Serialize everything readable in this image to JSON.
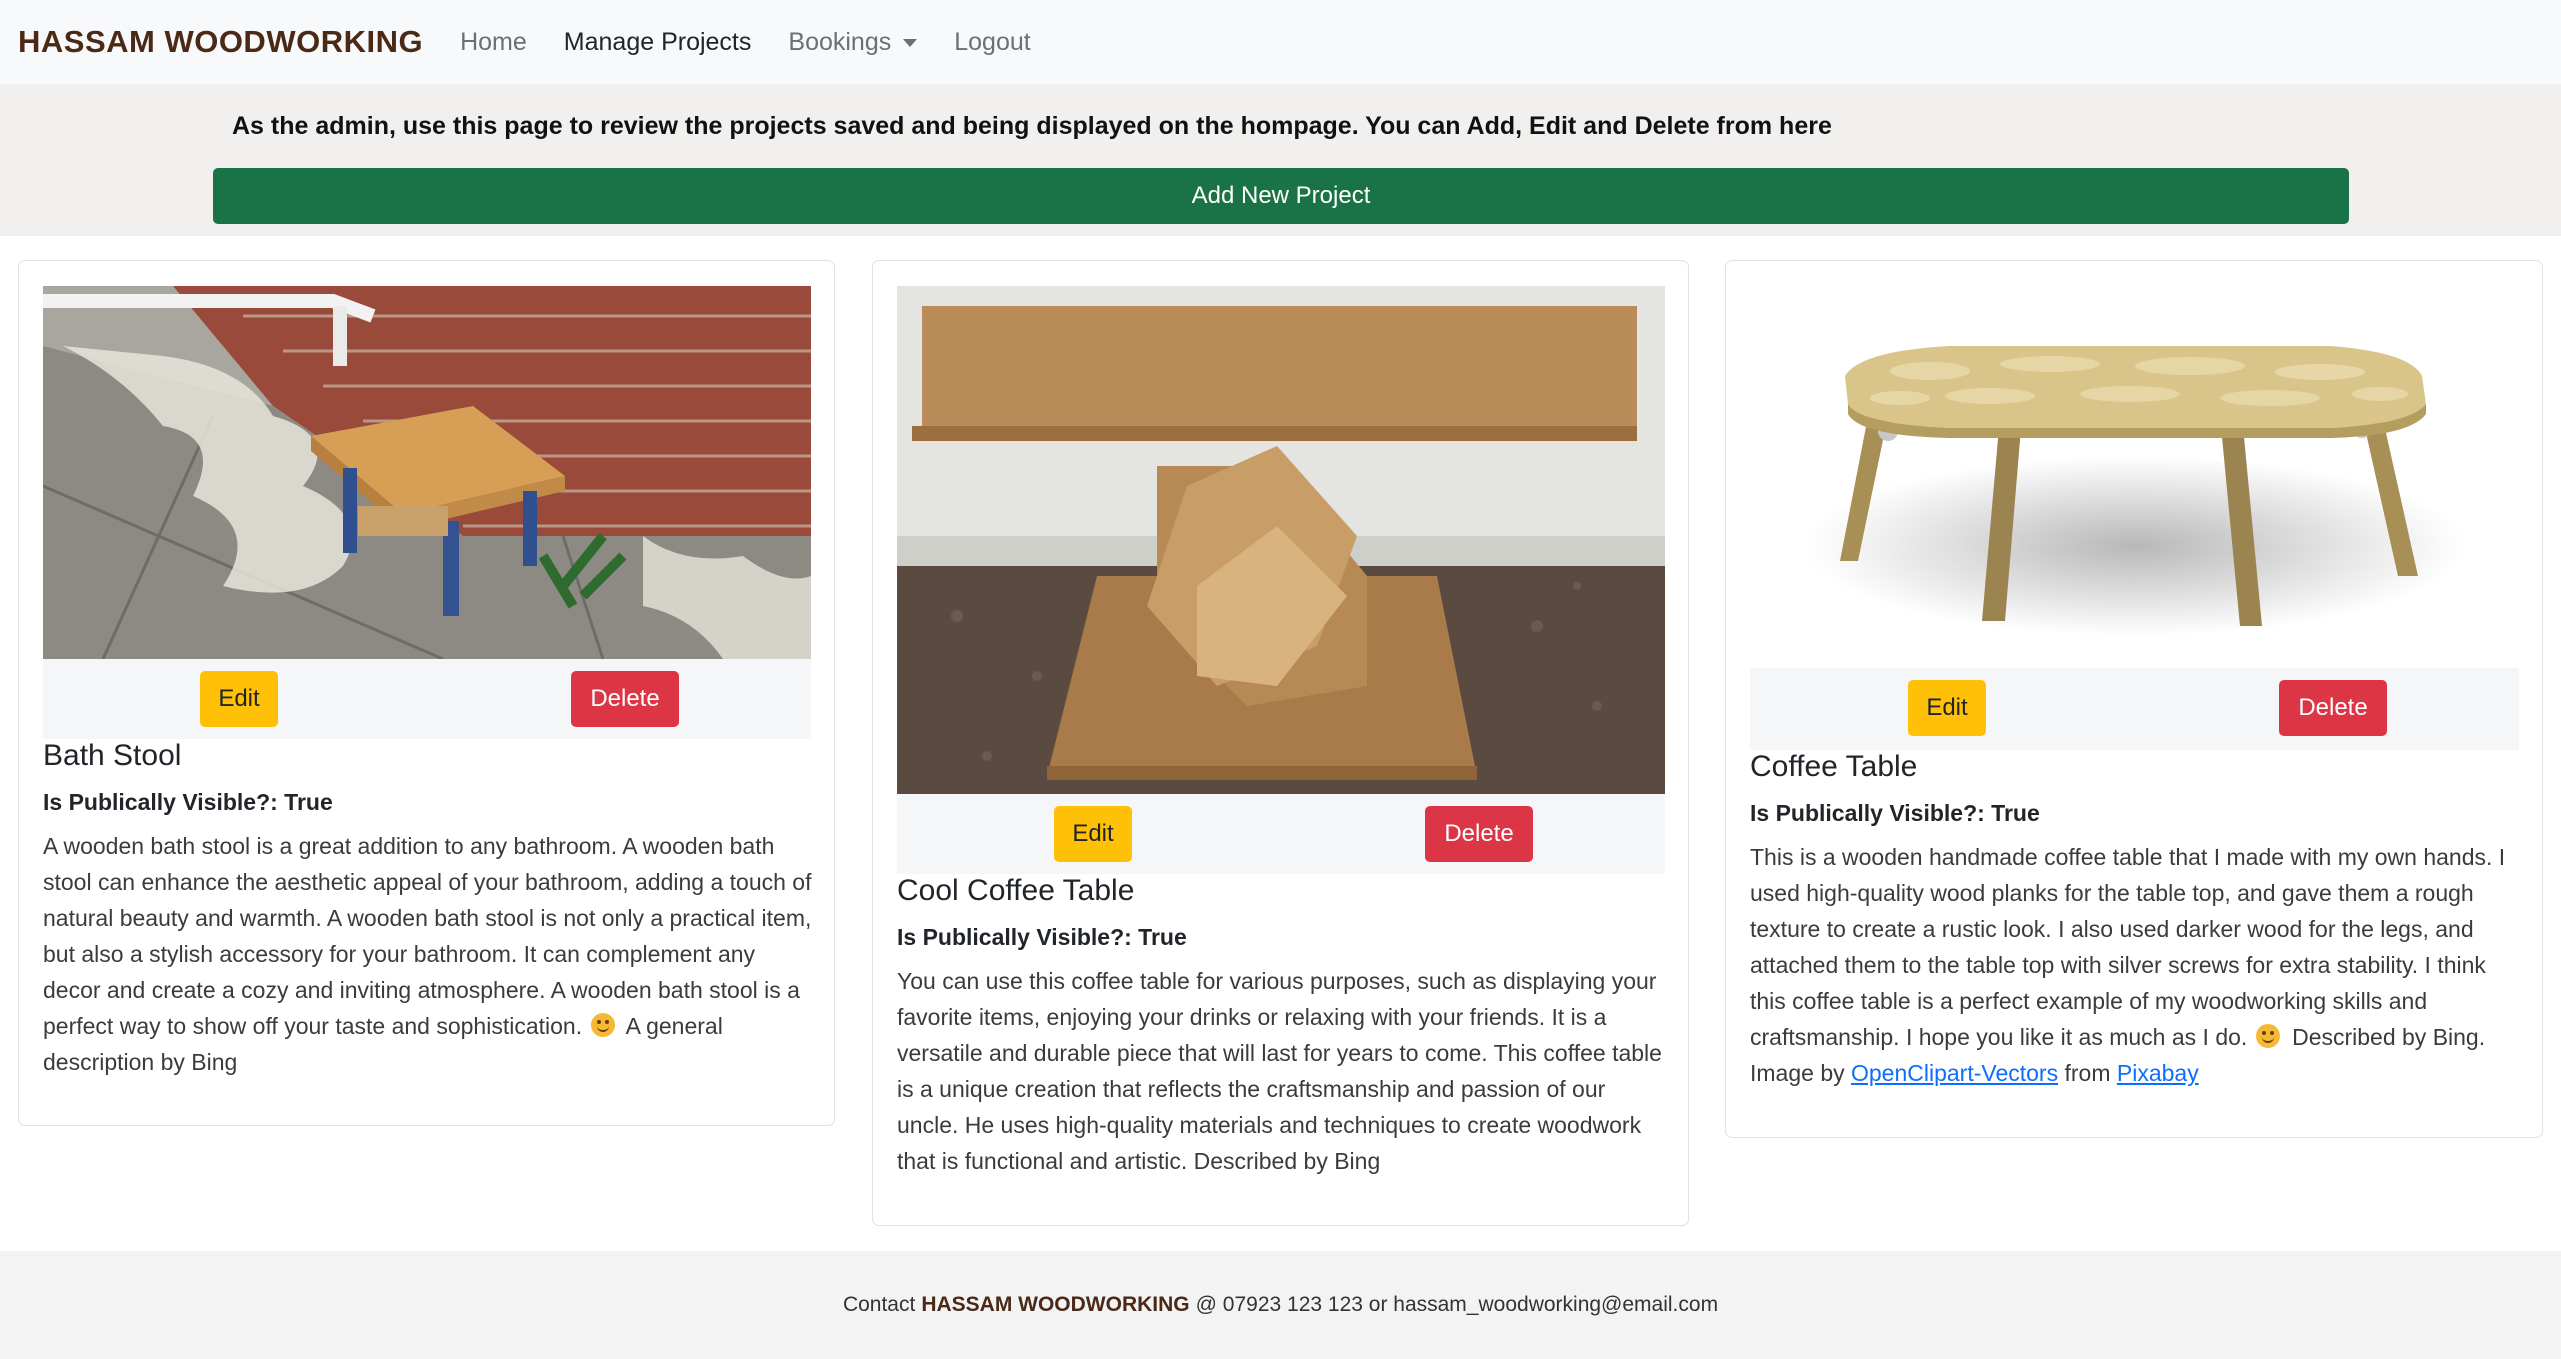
{
  "navbar": {
    "brand": "HASSAM WOODWORKING",
    "links": {
      "home": "Home",
      "manage": "Manage Projects",
      "bookings": "Bookings",
      "logout": "Logout"
    }
  },
  "banner": {
    "text": "As the admin, use this page to review the projects saved and being displayed on the hompage. You can Add, Edit and Delete from here",
    "add_button": "Add New Project"
  },
  "projects": [
    {
      "title": "Bath Stool",
      "visibility": "Is Publically Visible?: True",
      "edit_label": "Edit",
      "delete_label": "Delete",
      "description": "A wooden bath stool is a great addition to any bathroom. A wooden bath stool can enhance the aesthetic appeal of your bathroom, adding a touch of natural beauty and warmth. A wooden bath stool is not only a practical item, but also a stylish accessory for your bathroom. It can complement any decor and create a cozy and inviting atmosphere. A wooden bath stool is a perfect way to show off your taste and sophistication.",
      "description_tail": "A general description by Bing"
    },
    {
      "title": "Cool Coffee Table",
      "visibility": "Is Publically Visible?: True",
      "edit_label": "Edit",
      "delete_label": "Delete",
      "description": "You can use this coffee table for various purposes, such as displaying your favorite items, enjoying your drinks or relaxing with your friends. It is a versatile and durable piece that will last for years to come. This coffee table is a unique creation that reflects the craftsmanship and passion of our uncle. He uses high-quality materials and techniques to create woodwork that is functional and artistic. Described by Bing"
    },
    {
      "title": "Coffee Table",
      "visibility": "Is Publically Visible?: True",
      "edit_label": "Edit",
      "delete_label": "Delete",
      "description": "This is a wooden handmade coffee table that I made with my own hands. I used high-quality wood planks for the table top, and gave them a rough texture to create a rustic look. I also used darker wood for the legs, and attached them to the table top with silver screws for extra stability. I think this coffee table is a perfect example of my woodworking skills and craftsmanship. I hope you like it as much as I do.",
      "credit_prefix": "Described by Bing. Image by",
      "credit_link1": "OpenClipart-Vectors",
      "credit_mid": "from",
      "credit_link2": "Pixabay"
    }
  ],
  "footer": {
    "prefix": "Contact",
    "brand": "HASSAM WOODWORKING",
    "suffix": "@ 07923 123 123 or hassam_woodworking@email.com"
  }
}
